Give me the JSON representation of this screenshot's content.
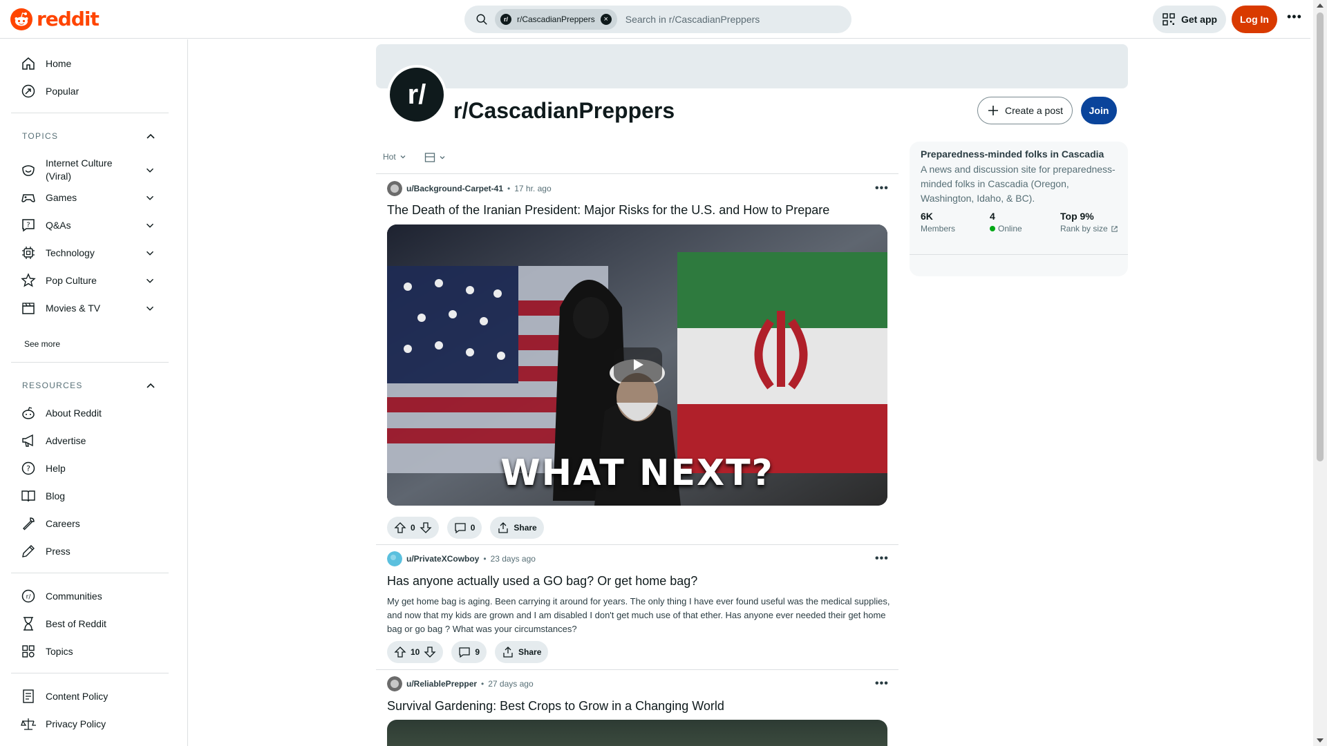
{
  "header": {
    "logo_text": "reddit",
    "search_chip": "r/CascadianPreppers",
    "search_chip_avatar": "r/",
    "search_placeholder": "Search in r/CascadianPreppers",
    "get_app_label": "Get app",
    "login_label": "Log In",
    "accent_color": "#ff4500"
  },
  "sidebar": {
    "primary": [
      {
        "label": "Home",
        "icon": "home-icon"
      },
      {
        "label": "Popular",
        "icon": "popular-icon"
      }
    ],
    "topics_label": "TOPICS",
    "topics": [
      {
        "label": "Internet Culture (Viral)",
        "icon": "smile-icon"
      },
      {
        "label": "Games",
        "icon": "gamepad-icon"
      },
      {
        "label": "Q&As",
        "icon": "question-bubble-icon"
      },
      {
        "label": "Technology",
        "icon": "chip-icon"
      },
      {
        "label": "Pop Culture",
        "icon": "star-icon"
      },
      {
        "label": "Movies & TV",
        "icon": "clapperboard-icon"
      }
    ],
    "see_more": "See more",
    "resources_label": "RESOURCES",
    "resources": [
      {
        "label": "About Reddit",
        "icon": "reddit-icon"
      },
      {
        "label": "Advertise",
        "icon": "megaphone-icon"
      },
      {
        "label": "Help",
        "icon": "help-icon"
      },
      {
        "label": "Blog",
        "icon": "book-icon"
      },
      {
        "label": "Careers",
        "icon": "wrench-icon"
      },
      {
        "label": "Press",
        "icon": "pen-icon"
      }
    ],
    "explore": [
      {
        "label": "Communities",
        "icon": "communities-icon"
      },
      {
        "label": "Best of Reddit",
        "icon": "hourglass-icon"
      },
      {
        "label": "Topics",
        "icon": "grid-icon"
      }
    ],
    "policies": [
      {
        "label": "Content Policy",
        "icon": "policy-icon"
      },
      {
        "label": "Privacy Policy",
        "icon": "scale-icon"
      }
    ]
  },
  "subreddit": {
    "name": "r/CascadianPreppers",
    "avatar_text": "r/",
    "create_post_label": "Create a post",
    "join_label": "Join"
  },
  "feed": {
    "sort_label": "Hot",
    "posts": [
      {
        "user": "u/Background-Carpet-41",
        "time": "17 hr. ago",
        "title": "The Death of the Iranian President: Major Risks for the U.S. and How to Prepare",
        "media_caption": "WHAT NEXT?",
        "votes": "0",
        "comments": "0",
        "share": "Share"
      },
      {
        "user": "u/PrivateXCowboy",
        "time": "23 days ago",
        "title": "Has anyone actually used a GO bag? Or get home bag?",
        "body": "My get home bag is aging. Been carrying it around for years. The only thing I have ever found useful was the medical supplies, and now that my kids are grown and I am disabled I don't get much use of that ether. Has anyone ever needed their get home bag or go bag ? What was your circumstances?",
        "votes": "10",
        "comments": "9",
        "share": "Share"
      },
      {
        "user": "u/ReliablePrepper",
        "time": "27 days ago",
        "title": "Survival Gardening: Best Crops to Grow in a Changing World"
      }
    ]
  },
  "about": {
    "title": "Preparedness-minded folks in Cascadia",
    "description": "A news and discussion site for preparedness-minded folks in Cascadia (Oregon, Washington, Idaho, & BC).",
    "members_value": "6K",
    "members_label": "Members",
    "online_value": "4",
    "online_label": "Online",
    "rank_value": "Top 9%",
    "rank_label": "Rank by size"
  }
}
